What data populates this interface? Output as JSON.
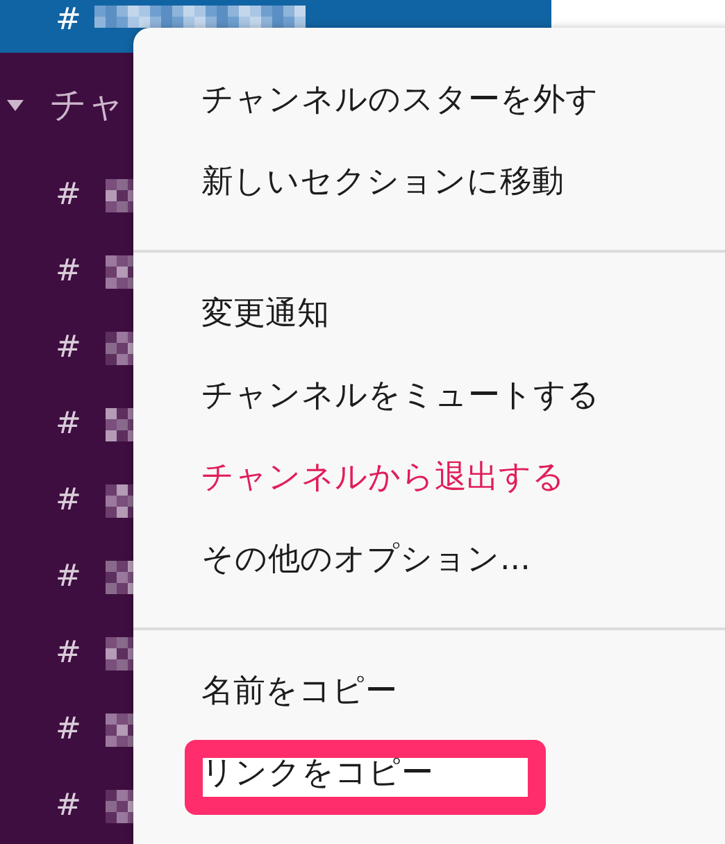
{
  "sidebar": {
    "current_channel": {
      "prefix": "#",
      "selected": true
    },
    "section": {
      "label": "チャ",
      "expanded": true
    },
    "channels": [
      {
        "prefix": "#",
        "selected": false
      },
      {
        "prefix": "#",
        "selected": false
      },
      {
        "prefix": "#",
        "selected": false
      },
      {
        "prefix": "#",
        "selected": false
      },
      {
        "prefix": "#",
        "selected": false
      },
      {
        "prefix": "#",
        "selected": false
      },
      {
        "prefix": "#",
        "selected": false
      },
      {
        "prefix": "#",
        "selected": false
      },
      {
        "prefix": "#",
        "selected": false
      }
    ]
  },
  "context_menu": {
    "groups": [
      {
        "items": [
          {
            "label": "チャンネルのスターを外す",
            "kind": "normal",
            "highlighted": false
          },
          {
            "label": "新しいセクションに移動",
            "kind": "normal",
            "highlighted": false
          }
        ]
      },
      {
        "items": [
          {
            "label": "変更通知",
            "kind": "normal",
            "highlighted": false
          },
          {
            "label": "チャンネルをミュートする",
            "kind": "normal",
            "highlighted": false
          },
          {
            "label": "チャンネルから退出する",
            "kind": "danger",
            "highlighted": false
          },
          {
            "label": "その他のオプション...",
            "kind": "normal",
            "highlighted": false
          }
        ]
      },
      {
        "items": [
          {
            "label": "名前をコピー",
            "kind": "normal",
            "highlighted": false
          },
          {
            "label": "リンクをコピー",
            "kind": "normal",
            "highlighted": true
          }
        ]
      }
    ]
  }
}
